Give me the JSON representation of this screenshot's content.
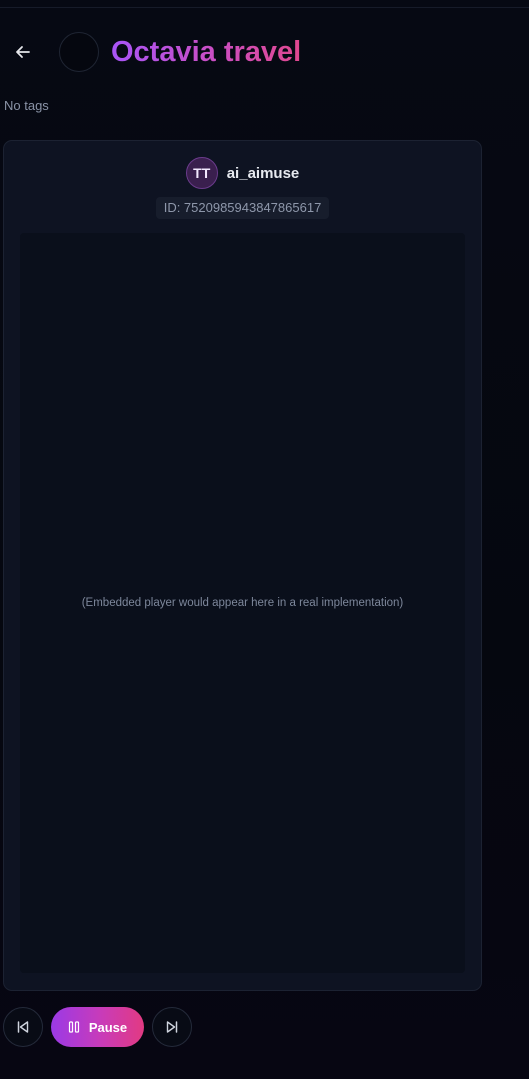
{
  "header": {
    "title": "Octavia travel"
  },
  "tags_text": "No tags",
  "video": {
    "username": "ai_aimuse",
    "avatar_initials": "TT",
    "id_label": "ID: 7520985943847865617",
    "player_placeholder": "(Embedded player would appear here in a real implementation)"
  },
  "controls": {
    "pause_label": "Pause"
  },
  "icons": {
    "back": "arrow-left-icon",
    "prev": "skip-back-icon",
    "pause": "pause-icon",
    "next": "skip-forward-icon"
  },
  "colors": {
    "accent_start": "#a855f7",
    "accent_end": "#e0488f",
    "background": "#050810",
    "card": "#0e1322"
  }
}
